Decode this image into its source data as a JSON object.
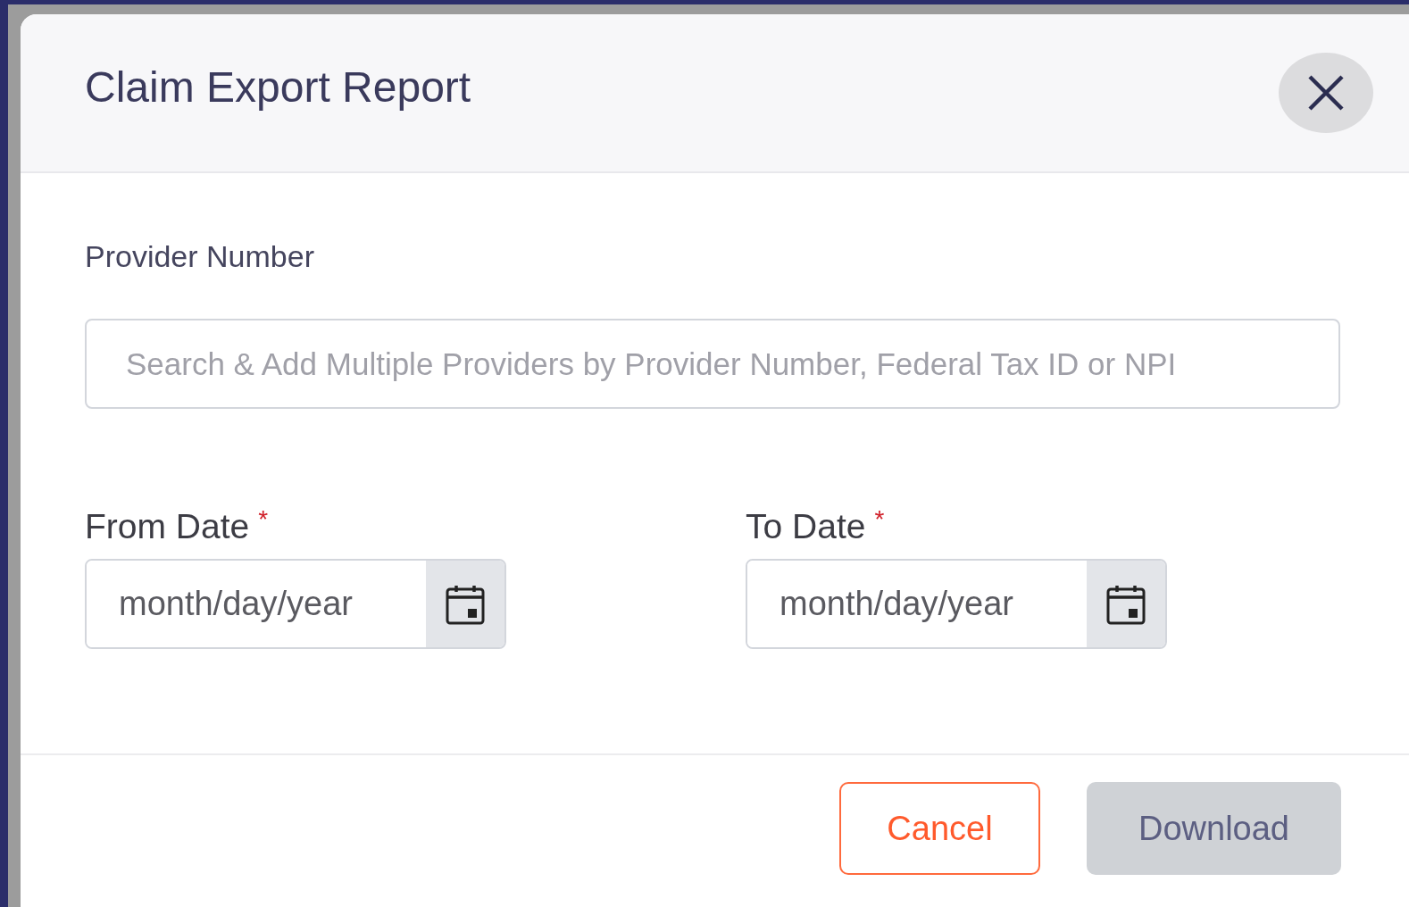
{
  "dialog": {
    "title": "Claim Export Report"
  },
  "provider_field": {
    "label": "Provider Number",
    "placeholder": "Search & Add Multiple Providers by Provider Number, Federal Tax ID or NPI"
  },
  "date_fields": [
    {
      "label": "From Date",
      "required_mark": "*",
      "placeholder": "month/day/year"
    },
    {
      "label": "To Date",
      "required_mark": "*",
      "placeholder": "month/day/year"
    }
  ],
  "buttons": [
    {
      "kind": "outline",
      "label": "Cancel",
      "disabled": false
    },
    {
      "kind": "primary",
      "label": "Download",
      "disabled": true
    }
  ]
}
